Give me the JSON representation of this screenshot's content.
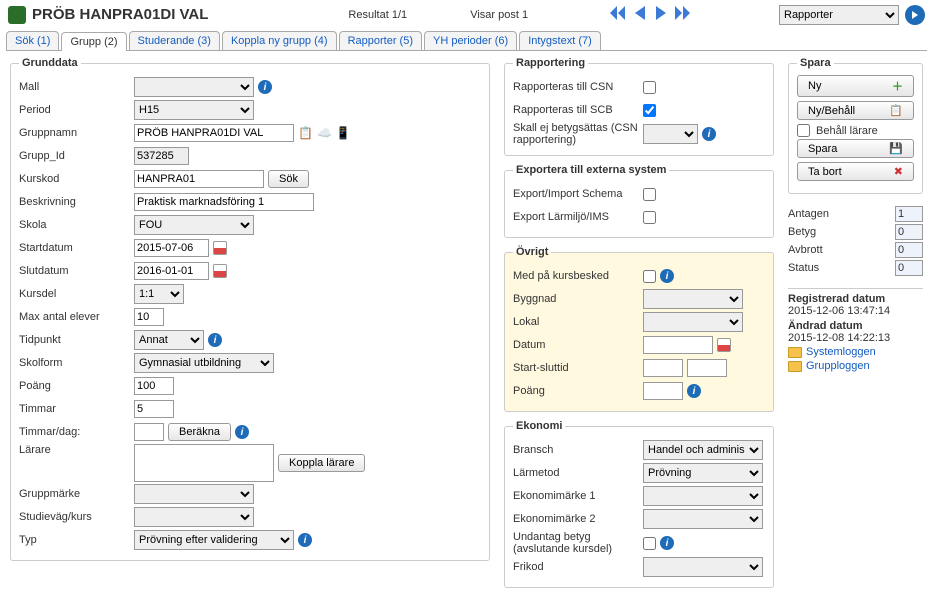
{
  "header": {
    "title": "PRÖB HANPRA01DI VAL",
    "resultat": "Resultat 1/1",
    "visar": "Visar post 1",
    "rapporter_sel": "Rapporter"
  },
  "tabs": [
    {
      "label": "Sök (1)"
    },
    {
      "label": "Grupp (2)"
    },
    {
      "label": "Studerande (3)"
    },
    {
      "label": "Koppla ny grupp (4)"
    },
    {
      "label": "Rapporter (5)"
    },
    {
      "label": "YH perioder (6)"
    },
    {
      "label": "Intygstext (7)"
    }
  ],
  "grunddata": {
    "legend": "Grunddata",
    "mall_lbl": "Mall",
    "mall_val": "",
    "period_lbl": "Period",
    "period_val": "H15",
    "gruppnamn_lbl": "Gruppnamn",
    "gruppnamn_val": "PRÖB HANPRA01DI VAL",
    "gruppid_lbl": "Grupp_Id",
    "gruppid_val": "537285",
    "kurskod_lbl": "Kurskod",
    "kurskod_val": "HANPRA01",
    "sok_btn": "Sök",
    "beskrivning_lbl": "Beskrivning",
    "beskrivning_val": "Praktisk marknadsföring 1",
    "skola_lbl": "Skola",
    "skola_val": "FOU",
    "startdatum_lbl": "Startdatum",
    "startdatum_val": "2015-07-06",
    "slutdatum_lbl": "Slutdatum",
    "slutdatum_val": "2016-01-01",
    "kursdel_lbl": "Kursdel",
    "kursdel_val": "1:1",
    "maxelever_lbl": "Max antal elever",
    "maxelever_val": "10",
    "tidpunkt_lbl": "Tidpunkt",
    "tidpunkt_val": "Annat",
    "skolform_lbl": "Skolform",
    "skolform_val": "Gymnasial utbildning",
    "poang_lbl": "Poäng",
    "poang_val": "100",
    "timmar_lbl": "Timmar",
    "timmar_val": "5",
    "timmardag_lbl": "Timmar/dag:",
    "timmardag_val": "",
    "berakna_btn": "Beräkna",
    "larare_lbl": "Lärare",
    "koppla_larare_btn": "Koppla lärare",
    "gruppmarke_lbl": "Gruppmärke",
    "studievag_lbl": "Studieväg/kurs",
    "typ_lbl": "Typ",
    "typ_val": "Prövning efter validering"
  },
  "rapportering": {
    "legend": "Rapportering",
    "csn_lbl": "Rapporteras till CSN",
    "csn_checked": false,
    "scb_lbl": "Rapporteras till SCB",
    "scb_checked": true,
    "skall_ej_lbl": "Skall ej betygsättas (CSN rapportering)"
  },
  "exportera": {
    "legend": "Exportera till externa system",
    "schema_lbl": "Export/Import Schema",
    "larmiljo_lbl": "Export Lärmiljö/IMS"
  },
  "ovrigt": {
    "legend": "Övrigt",
    "kursbesked_lbl": "Med på kursbesked",
    "byggnad_lbl": "Byggnad",
    "lokal_lbl": "Lokal",
    "datum_lbl": "Datum",
    "startslut_lbl": "Start-sluttid",
    "poang_lbl": "Poäng"
  },
  "ekonomi": {
    "legend": "Ekonomi",
    "bransch_lbl": "Bransch",
    "bransch_val": "Handel och adminis",
    "larmetod_lbl": "Lärmetod",
    "larmetod_val": "Prövning",
    "eko1_lbl": "Ekonomimärke 1",
    "eko2_lbl": "Ekonomimärke 2",
    "undantag_lbl": "Undantag betyg (avslutande kursdel)",
    "frikod_lbl": "Frikod"
  },
  "spara": {
    "legend": "Spara",
    "ny": "Ny",
    "nybehall": "Ny/Behåll",
    "behall_larare": "Behåll lärare",
    "spara": "Spara",
    "tabort": "Ta bort"
  },
  "stats": {
    "antagen_lbl": "Antagen",
    "antagen_val": "1",
    "betyg_lbl": "Betyg",
    "betyg_val": "0",
    "avbrott_lbl": "Avbrott",
    "avbrott_val": "0",
    "status_lbl": "Status",
    "status_val": "0"
  },
  "meta": {
    "reg_lbl": "Registrerad datum",
    "reg_val": "2015-12-06 13:47:14",
    "andrad_lbl": "Ändrad datum",
    "andrad_val": "2015-12-08 14:22:13",
    "systemloggen": "Systemloggen",
    "grupploggen": "Grupploggen"
  }
}
